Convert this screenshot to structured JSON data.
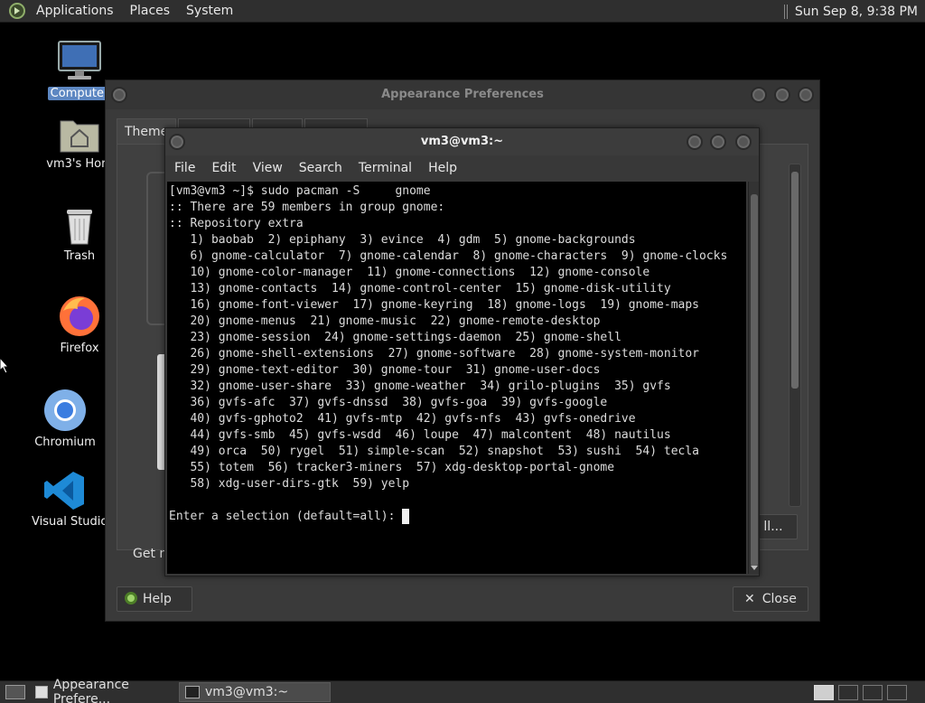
{
  "top_panel": {
    "menus": [
      "Applications",
      "Places",
      "System"
    ],
    "clock": "Sun Sep  8,  9:38 PM"
  },
  "desktop": {
    "icons": [
      {
        "label": "Computer",
        "icon": "computer-icon"
      },
      {
        "label": "vm3's Hom",
        "icon": "home-folder-icon"
      },
      {
        "label": "Trash",
        "icon": "trash-icon"
      },
      {
        "label": "Firefox",
        "icon": "firefox-icon"
      },
      {
        "label": "Chromium",
        "icon": "chromium-icon"
      },
      {
        "label": "Visual Studio Co",
        "icon": "vscode-icon"
      }
    ]
  },
  "appearance": {
    "title": "Appearance Preferences",
    "tab_theme": "Theme",
    "bottom_text": "Get m",
    "partial_button": "ll...",
    "help_label": "Help",
    "close_label": "Close"
  },
  "terminal": {
    "title": "vm3@vm3:~",
    "menus": [
      "File",
      "Edit",
      "View",
      "Search",
      "Terminal",
      "Help"
    ],
    "lines": [
      "[vm3@vm3 ~]$ sudo pacman -S     gnome",
      ":: There are 59 members in group gnome:",
      ":: Repository extra",
      "   1) baobab  2) epiphany  3) evince  4) gdm  5) gnome-backgrounds",
      "   6) gnome-calculator  7) gnome-calendar  8) gnome-characters  9) gnome-clocks",
      "   10) gnome-color-manager  11) gnome-connections  12) gnome-console",
      "   13) gnome-contacts  14) gnome-control-center  15) gnome-disk-utility",
      "   16) gnome-font-viewer  17) gnome-keyring  18) gnome-logs  19) gnome-maps",
      "   20) gnome-menus  21) gnome-music  22) gnome-remote-desktop",
      "   23) gnome-session  24) gnome-settings-daemon  25) gnome-shell",
      "   26) gnome-shell-extensions  27) gnome-software  28) gnome-system-monitor",
      "   29) gnome-text-editor  30) gnome-tour  31) gnome-user-docs",
      "   32) gnome-user-share  33) gnome-weather  34) grilo-plugins  35) gvfs",
      "   36) gvfs-afc  37) gvfs-dnssd  38) gvfs-goa  39) gvfs-google",
      "   40) gvfs-gphoto2  41) gvfs-mtp  42) gvfs-nfs  43) gvfs-onedrive",
      "   44) gvfs-smb  45) gvfs-wsdd  46) loupe  47) malcontent  48) nautilus",
      "   49) orca  50) rygel  51) simple-scan  52) snapshot  53) sushi  54) tecla",
      "   55) totem  56) tracker3-miners  57) xdg-desktop-portal-gnome",
      "   58) xdg-user-dirs-gtk  59) yelp",
      "",
      "Enter a selection (default=all): "
    ]
  },
  "taskbar": {
    "items": [
      {
        "label": "Appearance Prefere..."
      },
      {
        "label": "vm3@vm3:~"
      }
    ]
  }
}
